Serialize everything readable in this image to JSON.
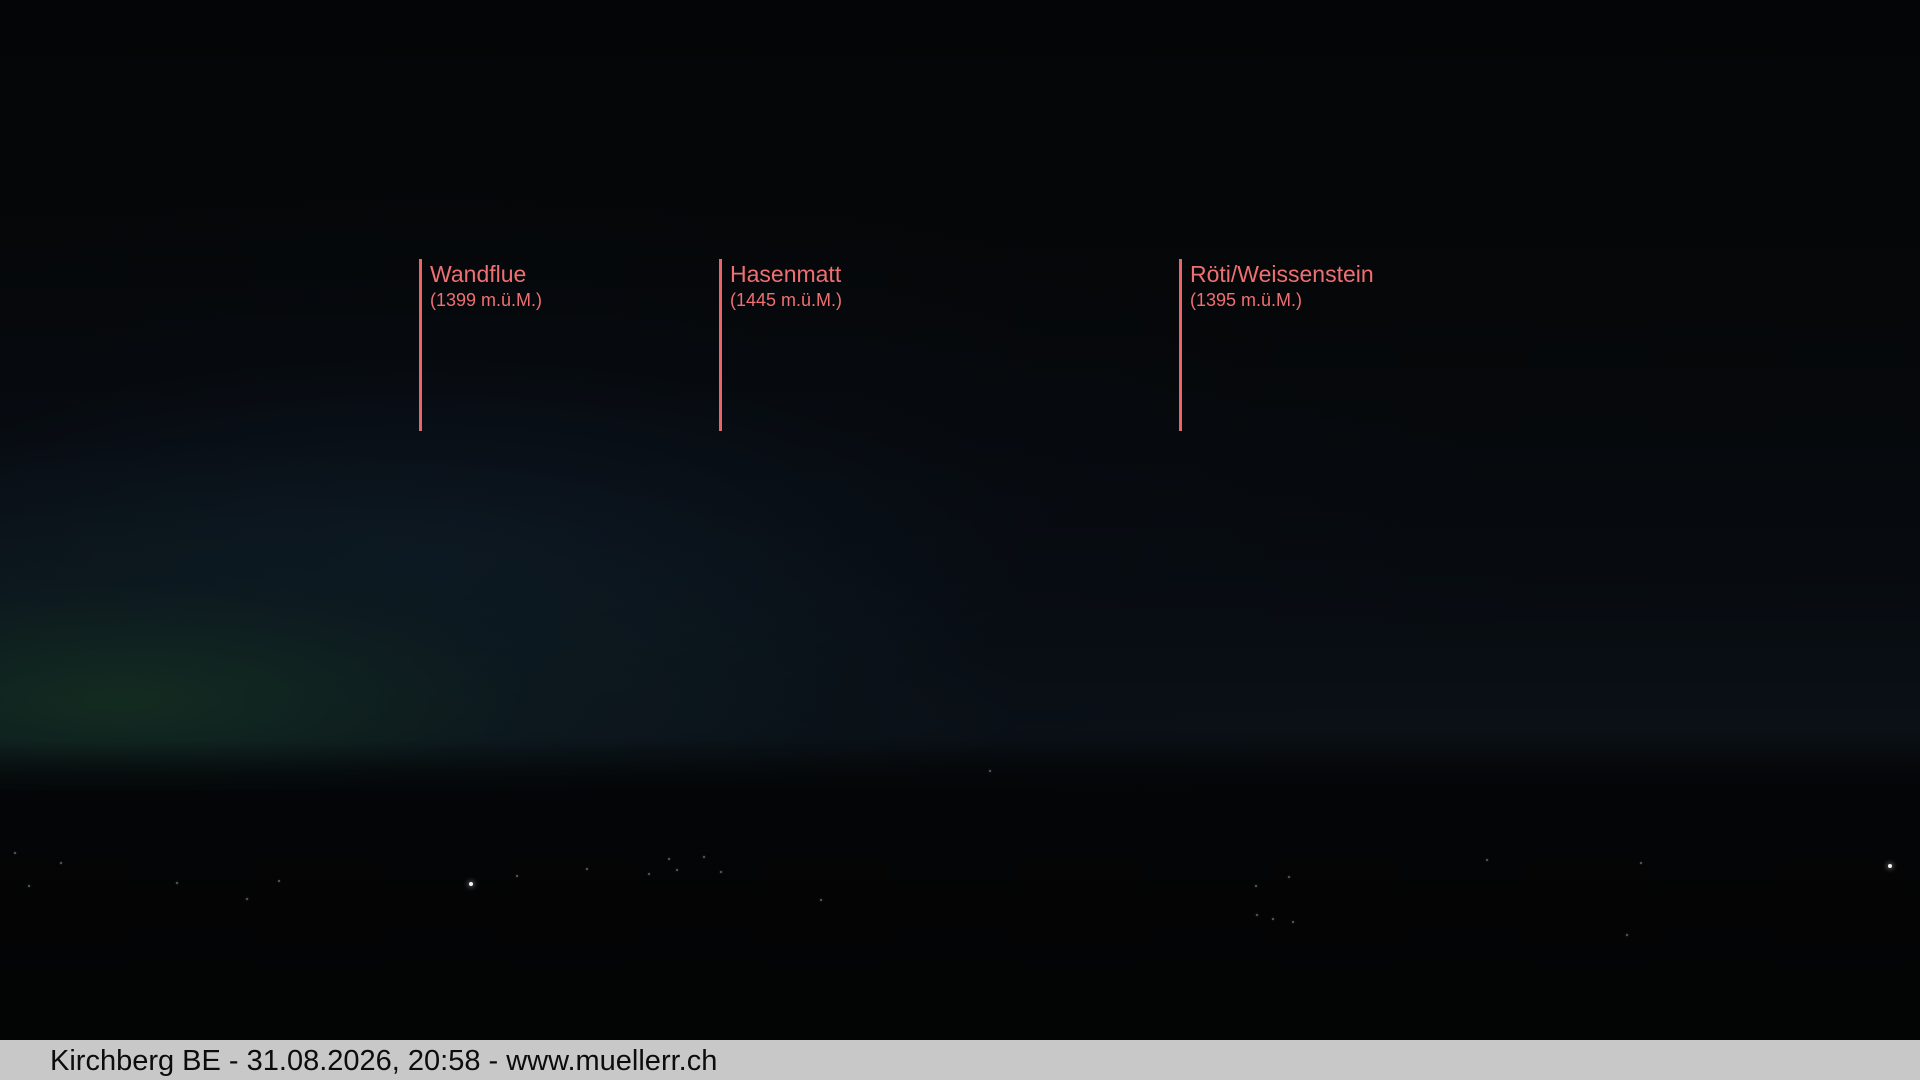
{
  "peaks": [
    {
      "name": "Wandflue",
      "elevation": "(1399 m.ü.M.)"
    },
    {
      "name": "Hasenmatt",
      "elevation": "(1445 m.ü.M.)"
    },
    {
      "name": "Röti/Weissenstein",
      "elevation": "(1395 m.ü.M.)"
    }
  ],
  "caption": {
    "text": "Kirchberg BE - 31.08.2026, 20:58 - www.muellerr.ch"
  },
  "colors": {
    "marker": "#e8666a",
    "caption_bar": "#c8c8c8"
  }
}
